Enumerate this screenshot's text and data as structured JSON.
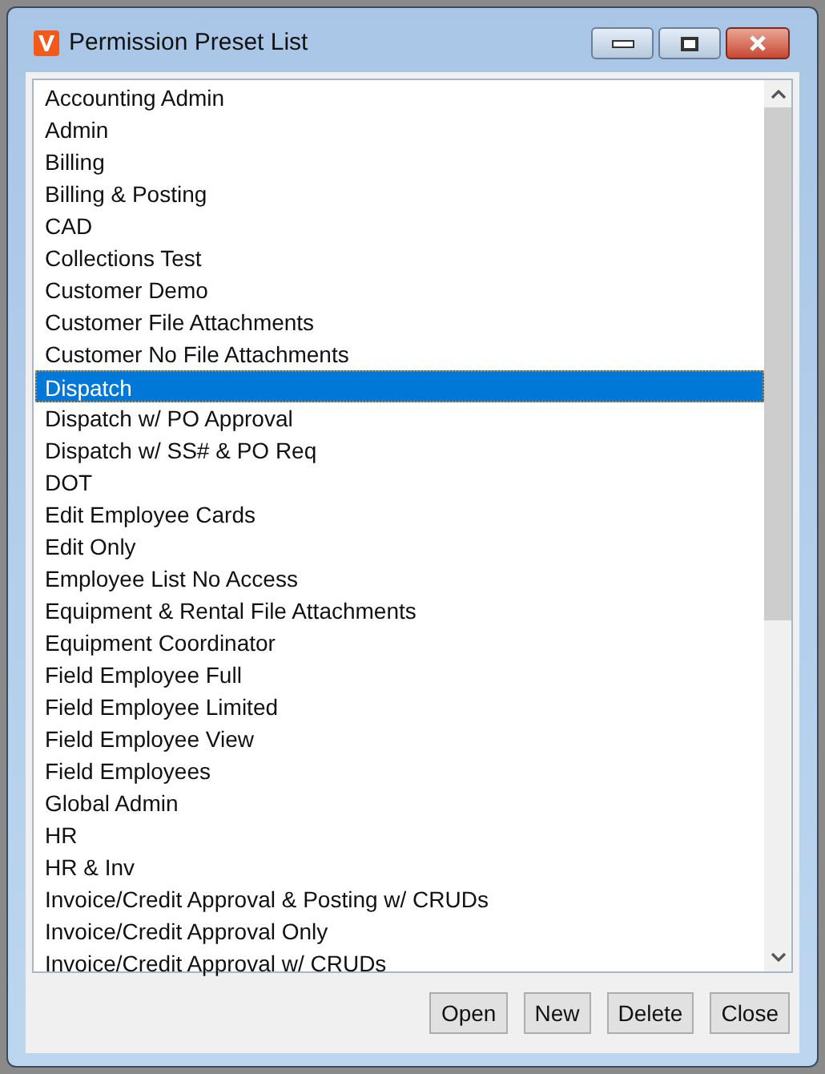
{
  "window": {
    "title": "Permission Preset List"
  },
  "list": {
    "items": [
      {
        "label": "Accounting Admin",
        "selected": false
      },
      {
        "label": "Admin",
        "selected": false
      },
      {
        "label": "Billing",
        "selected": false
      },
      {
        "label": "Billing & Posting",
        "selected": false
      },
      {
        "label": "CAD",
        "selected": false
      },
      {
        "label": "Collections Test",
        "selected": false
      },
      {
        "label": "Customer Demo",
        "selected": false
      },
      {
        "label": "Customer File Attachments",
        "selected": false
      },
      {
        "label": "Customer No File Attachments",
        "selected": false
      },
      {
        "label": "Dispatch",
        "selected": true
      },
      {
        "label": "Dispatch w/ PO Approval",
        "selected": false
      },
      {
        "label": "Dispatch w/ SS# & PO Req",
        "selected": false
      },
      {
        "label": "DOT",
        "selected": false
      },
      {
        "label": "Edit Employee Cards",
        "selected": false
      },
      {
        "label": "Edit Only",
        "selected": false
      },
      {
        "label": "Employee List No Access",
        "selected": false
      },
      {
        "label": "Equipment & Rental File Attachments",
        "selected": false
      },
      {
        "label": "Equipment Coordinator",
        "selected": false
      },
      {
        "label": "Field Employee Full",
        "selected": false
      },
      {
        "label": "Field Employee Limited",
        "selected": false
      },
      {
        "label": "Field Employee View",
        "selected": false
      },
      {
        "label": "Field Employees",
        "selected": false
      },
      {
        "label": "Global Admin",
        "selected": false
      },
      {
        "label": "HR",
        "selected": false
      },
      {
        "label": "HR & Inv",
        "selected": false
      },
      {
        "label": "Invoice/Credit Approval & Posting w/ CRUDs",
        "selected": false
      },
      {
        "label": "Invoice/Credit Approval Only",
        "selected": false
      },
      {
        "label": "Invoice/Credit Approval w/ CRUDs",
        "selected": false
      }
    ]
  },
  "buttons": [
    "Open",
    "New",
    "Delete",
    "Close"
  ]
}
